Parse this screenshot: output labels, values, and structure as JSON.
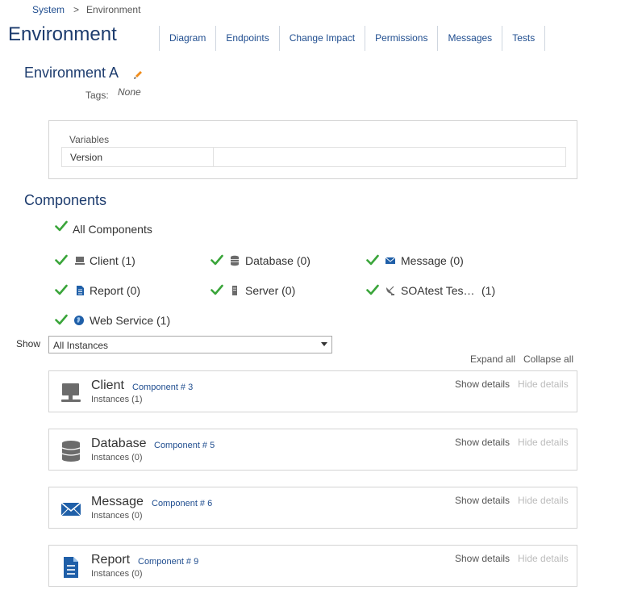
{
  "breadcrumb": {
    "root": "System",
    "separator": ">",
    "current": "Environment"
  },
  "page": {
    "title": "Environment"
  },
  "tabs": [
    {
      "label": "Diagram"
    },
    {
      "label": "Endpoints"
    },
    {
      "label": "Change Impact"
    },
    {
      "label": "Permissions"
    },
    {
      "label": "Messages"
    },
    {
      "label": "Tests"
    }
  ],
  "environment": {
    "name": "Environment A",
    "tags_label": "Tags:",
    "tags_value": "None"
  },
  "variables": {
    "title": "Variables",
    "rows": [
      {
        "name": "Version",
        "value": ""
      }
    ]
  },
  "components": {
    "title": "Components",
    "all_label": "All Components",
    "filters": [
      {
        "label": "Client (1)",
        "icon": "monitor-icon"
      },
      {
        "label": "Database (0)",
        "icon": "database-icon"
      },
      {
        "label": "Message (0)",
        "icon": "envelope-icon"
      },
      {
        "label": "Report (0)",
        "icon": "document-icon"
      },
      {
        "label": "Server (0)",
        "icon": "server-icon"
      },
      {
        "label": "SOAtest Tes…",
        "count": "(1)",
        "icon": "satellite-dish-icon"
      },
      {
        "label": "Web Service (1)",
        "icon": "globe-icon"
      }
    ]
  },
  "show": {
    "label": "Show",
    "selected": "All Instances"
  },
  "actions": {
    "expand_all": "Expand all",
    "collapse_all": "Collapse all"
  },
  "cards": [
    {
      "name": "Client",
      "component": "Component # 3",
      "instances": "Instances (1)",
      "show": "Show details",
      "hide": "Hide details",
      "icon": "monitor-icon"
    },
    {
      "name": "Database",
      "component": "Component # 5",
      "instances": "Instances (0)",
      "show": "Show details",
      "hide": "Hide details",
      "icon": "database-icon"
    },
    {
      "name": "Message",
      "component": "Component # 6",
      "instances": "Instances (0)",
      "show": "Show details",
      "hide": "Hide details",
      "icon": "envelope-icon"
    },
    {
      "name": "Report",
      "component": "Component # 9",
      "instances": "Instances (0)",
      "show": "Show details",
      "hide": "Hide details",
      "icon": "document-icon"
    }
  ],
  "colors": {
    "title": "#1d3c6e",
    "link": "#1f4d8f",
    "check": "#3aa53a",
    "accent_edit": "#f08c1a",
    "icon_gray": "#6b6b6b",
    "icon_blue": "#1f5fa8"
  }
}
